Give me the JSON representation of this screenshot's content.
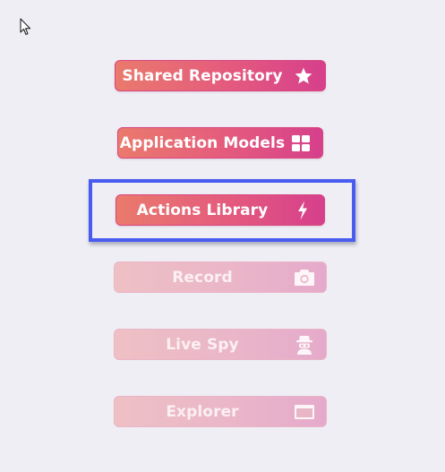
{
  "menu": {
    "items": [
      {
        "label": "Shared Repository",
        "icon": "star-icon",
        "state": "enabled"
      },
      {
        "label": "Application Models",
        "icon": "grid-icon",
        "state": "enabled"
      },
      {
        "label": "Actions Library",
        "icon": "lightning-icon",
        "state": "enabled",
        "focused": true
      },
      {
        "label": "Record",
        "icon": "camera-icon",
        "state": "disabled"
      },
      {
        "label": "Live Spy",
        "icon": "spy-icon",
        "state": "disabled"
      },
      {
        "label": "Explorer",
        "icon": "window-icon",
        "state": "disabled"
      }
    ]
  },
  "colors": {
    "background": "#eeeef4",
    "button_gradient_start": "#ea7a6c",
    "button_gradient_end": "#d63f8c",
    "focus_ring": "#4a5cf0"
  }
}
